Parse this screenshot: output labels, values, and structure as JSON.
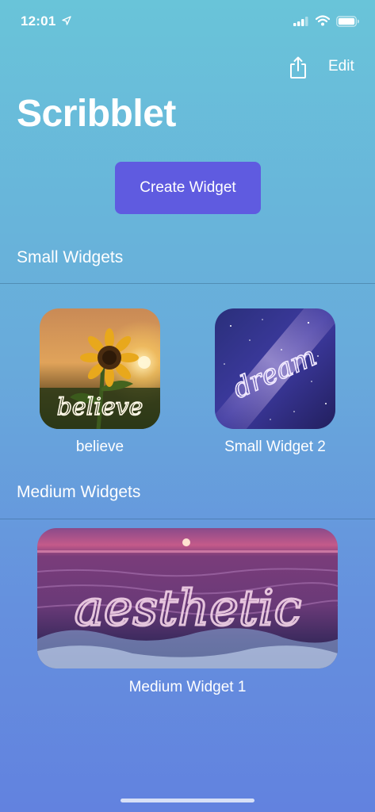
{
  "status_bar": {
    "time": "12:01"
  },
  "header": {
    "edit_label": "Edit",
    "title": "Scribblet"
  },
  "create_button_label": "Create Widget",
  "sections": {
    "small_title": "Small Widgets",
    "medium_title": "Medium Widgets"
  },
  "small_widgets": [
    {
      "label": "believe",
      "scribble_text": "believe"
    },
    {
      "label": "Small Widget 2",
      "scribble_text": "dream"
    }
  ],
  "medium_widgets": [
    {
      "label": "Medium Widget 1",
      "scribble_text": "aesthetic"
    }
  ],
  "colors": {
    "accent_button": "#5f5be0",
    "background_top": "#69c4d9",
    "background_bottom": "#6282df"
  }
}
